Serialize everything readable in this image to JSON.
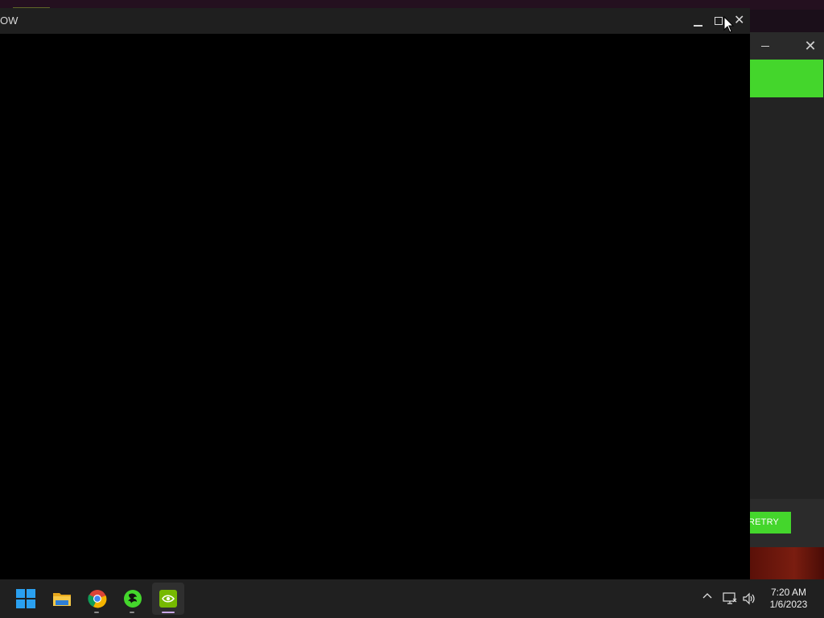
{
  "main_window": {
    "title": "OW",
    "controls": {
      "minimize": "minimize",
      "maximize": "maximize",
      "close": "✕"
    }
  },
  "back_window": {
    "close": "✕",
    "retry_label": "RETRY",
    "accent_color": "#44d62c"
  },
  "taskbar": {
    "apps": [
      {
        "name": "Start",
        "icon": "windows-start-icon"
      },
      {
        "name": "File Explorer",
        "icon": "file-explorer-icon"
      },
      {
        "name": "Google Chrome",
        "icon": "chrome-icon"
      },
      {
        "name": "Razer Synapse",
        "icon": "razer-icon"
      },
      {
        "name": "NVIDIA",
        "icon": "nvidia-icon",
        "active": true
      }
    ],
    "tray": {
      "chevron": "^",
      "network": "network-icon",
      "volume": "volume-icon"
    },
    "clock": {
      "time": "7:20 AM",
      "date": "1/6/2023"
    }
  }
}
